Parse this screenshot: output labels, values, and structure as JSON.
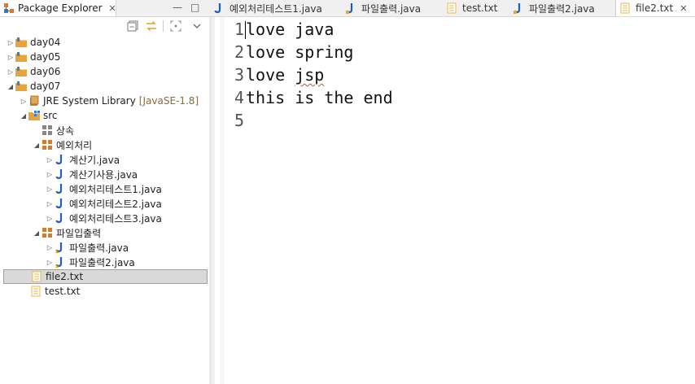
{
  "view": {
    "title": "Package Explorer",
    "close": "✕",
    "minimize": "—",
    "maximize": "□"
  },
  "editor_tabs": [
    {
      "label": "예외처리테스트1.java",
      "icon": "java-file-icon",
      "active": false
    },
    {
      "label": "파일출력.java",
      "icon": "java-file-icon",
      "active": false
    },
    {
      "label": "test.txt",
      "icon": "text-file-icon",
      "active": false
    },
    {
      "label": "파일출력2.java",
      "icon": "java-file-icon",
      "active": false
    },
    {
      "label": "file2.txt",
      "icon": "text-file-icon",
      "active": true,
      "close": "✕"
    }
  ],
  "explorer_toolbar": {
    "collapse_all": "collapse-all-icon",
    "link_with_editor": "link-editor-icon",
    "focus": "focus-icon",
    "view_menu": "view-menu-icon"
  },
  "tree": {
    "projects": [
      "day04",
      "day05",
      "day06",
      "day07"
    ],
    "jre": {
      "label": "JRE System Library",
      "detail": "[JavaSE-1.8]"
    },
    "src": "src",
    "packages": [
      {
        "name": "상속",
        "files": []
      },
      {
        "name": "예외처리",
        "files": [
          "계산기.java",
          "계산기사용.java",
          "예외처리테스트1.java",
          "예외처리테스트2.java",
          "예외처리테스트3.java"
        ]
      },
      {
        "name": "파일입출력",
        "files": [
          "파일출력.java",
          "파일출력2.java"
        ]
      }
    ],
    "root_files": [
      "file2.txt",
      "test.txt"
    ],
    "selected": "file2.txt"
  },
  "editor": {
    "lines": [
      {
        "num": "1",
        "text": "love java"
      },
      {
        "num": "2",
        "text": "love spring"
      },
      {
        "num": "3",
        "text": "love jsp"
      },
      {
        "num": "4",
        "text": "this is the end"
      },
      {
        "num": "5",
        "text": ""
      }
    ],
    "spell_flag": "jsp"
  },
  "colors": {
    "java_icon": "#1f5fbf",
    "folder": "#e8a33d",
    "package": "#d97a2b",
    "text_file": "#e8b84a",
    "selection": "#d9d9d9"
  }
}
